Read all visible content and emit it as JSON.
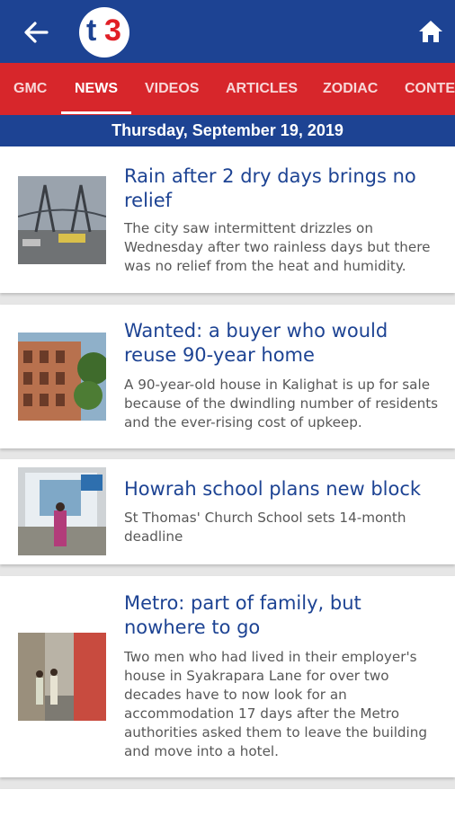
{
  "app": {
    "logo_text_t": "t",
    "logo_text_3": "3",
    "brand_blue": "#1d4393",
    "brand_red": "#d7262b"
  },
  "nav": {
    "tabs": [
      {
        "label": "GMC",
        "active": false
      },
      {
        "label": "NEWS",
        "active": true
      },
      {
        "label": "VIDEOS",
        "active": false
      },
      {
        "label": "ARTICLES",
        "active": false
      },
      {
        "label": "ZODIAC",
        "active": false
      },
      {
        "label": "CONTE",
        "active": false
      }
    ]
  },
  "date_bar": {
    "text": "Thursday, September 19, 2019"
  },
  "articles": [
    {
      "headline": "Rain after 2 dry days brings no relief",
      "summary": "The city saw intermittent drizzles on Wednesday after two rainless days but there was no relief from the heat and humidity.",
      "thumb": "bridge-photo"
    },
    {
      "headline": "Wanted: a buyer who would reuse 90-year home",
      "summary": "A 90-year-old house in Kalighat is up for sale because of the dwindling number of residents and the ever-rising cost of upkeep.",
      "thumb": "old-house-photo"
    },
    {
      "headline": "Howrah school plans new block",
      "summary": "St Thomas' Church School sets 14-month deadline",
      "thumb": "school-board-photo"
    },
    {
      "headline": "Metro: part of family, but nowhere to go",
      "summary": "Two men who had lived in their employer's house in Syakrapara Lane for over two decades have to now look for an accommodation 17 days after the Metro authorities asked them to leave the building and move into a hotel.",
      "thumb": "lane-photo"
    }
  ]
}
